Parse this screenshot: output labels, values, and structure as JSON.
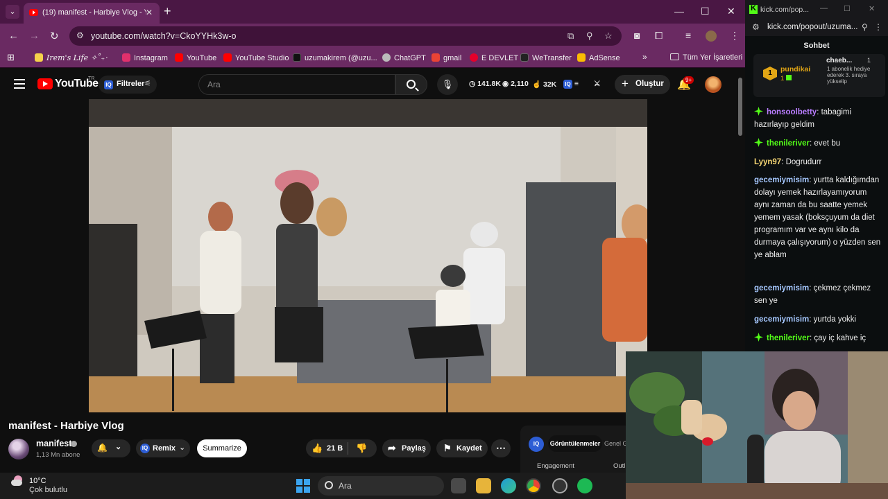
{
  "browser": {
    "tab_title": "(19) manifest - Harbiye Vlog - Y",
    "url": "youtube.com/watch?v=CkoYYHk3w-o",
    "bookmarks": [
      {
        "label": "Irem's Life ✧˚₊‧",
        "color": "#f5d24b"
      },
      {
        "label": "Instagram",
        "color": "#e1306c"
      },
      {
        "label": "YouTube",
        "color": "#ff0000"
      },
      {
        "label": "YouTube Studio",
        "color": "#ff0000"
      },
      {
        "label": "uzumakirem (@uzu...",
        "color": "#111111"
      },
      {
        "label": "ChatGPT",
        "color": "#bbbbbb"
      },
      {
        "label": "gmail",
        "color": "#ea4335"
      },
      {
        "label": "E DEVLET",
        "color": "#e4002b"
      },
      {
        "label": "WeTransfer",
        "color": "#222222"
      },
      {
        "label": "AdSense",
        "color": "#fbbc04"
      }
    ],
    "all_bookmarks": "Tüm Yer İşaretleri"
  },
  "youtube": {
    "logo_text": "YouTube",
    "region": "TR",
    "filters_label": "Filtreler",
    "search_placeholder": "Ara",
    "stats": {
      "watching": "141.8K",
      "views": "2,110",
      "likes": "32K"
    },
    "create_label": "Oluştur",
    "notifications": "9+",
    "video_title": "manifest - Harbiye Vlog",
    "channel_name": "manifest",
    "subscribers": "1,13 Mn abone",
    "remix_label": "Remix",
    "summarize_label": "Summarize",
    "like_count": "21 B",
    "share_label": "Paylaş",
    "save_label": "Kaydet",
    "panel": {
      "views_tab": "Görüntülenmeler",
      "general_tab": "Genel G",
      "engagement": "Engagement",
      "outliers": "Outl"
    }
  },
  "chat": {
    "title": "kick.com/pop...",
    "url": "kick.com/popout/uzuma...",
    "header": "Sohbet",
    "pinned": {
      "name": "pundikai",
      "count": "1",
      "right_name": "chaeb...",
      "right_count": "1",
      "right_text": "1 abonelik hediye ederek 3. sıraya yükselip"
    },
    "messages": [
      {
        "user": "honsoolbetty",
        "color": "#b97dff",
        "badge": true,
        "text": "tabagimi hazırlayıp geldim"
      },
      {
        "user": "thenileriver",
        "color": "#53fc18",
        "badge": true,
        "text": "evet bu"
      },
      {
        "user": "Lyyn97",
        "color": "#f7d774",
        "badge": false,
        "text": "Dogrudurr"
      },
      {
        "user": "gecemiymisim",
        "color": "#a6c8ff",
        "badge": false,
        "text": "yurtta kaldığımdan dolayı yemek hazırlayamıyorum aynı zaman da bu saatte yemek yemem yasak (boksçuyum da diet programım var ve aynı kilo da durmaya çalışıyorum) o yüzden sen ye ablam"
      },
      {
        "user": "gecemiymisim",
        "color": "#a6c8ff",
        "badge": false,
        "text": "çekmez çekmez sen ye"
      },
      {
        "user": "gecemiymisim",
        "color": "#a6c8ff",
        "badge": false,
        "text": "yurtda yokki"
      },
      {
        "user": "thenileriver",
        "color": "#53fc18",
        "badge": true,
        "text": "çay iç kahve iç"
      }
    ]
  },
  "taskbar": {
    "temperature": "10°C",
    "condition": "Çok bulutlu",
    "search_placeholder": "Ara"
  }
}
